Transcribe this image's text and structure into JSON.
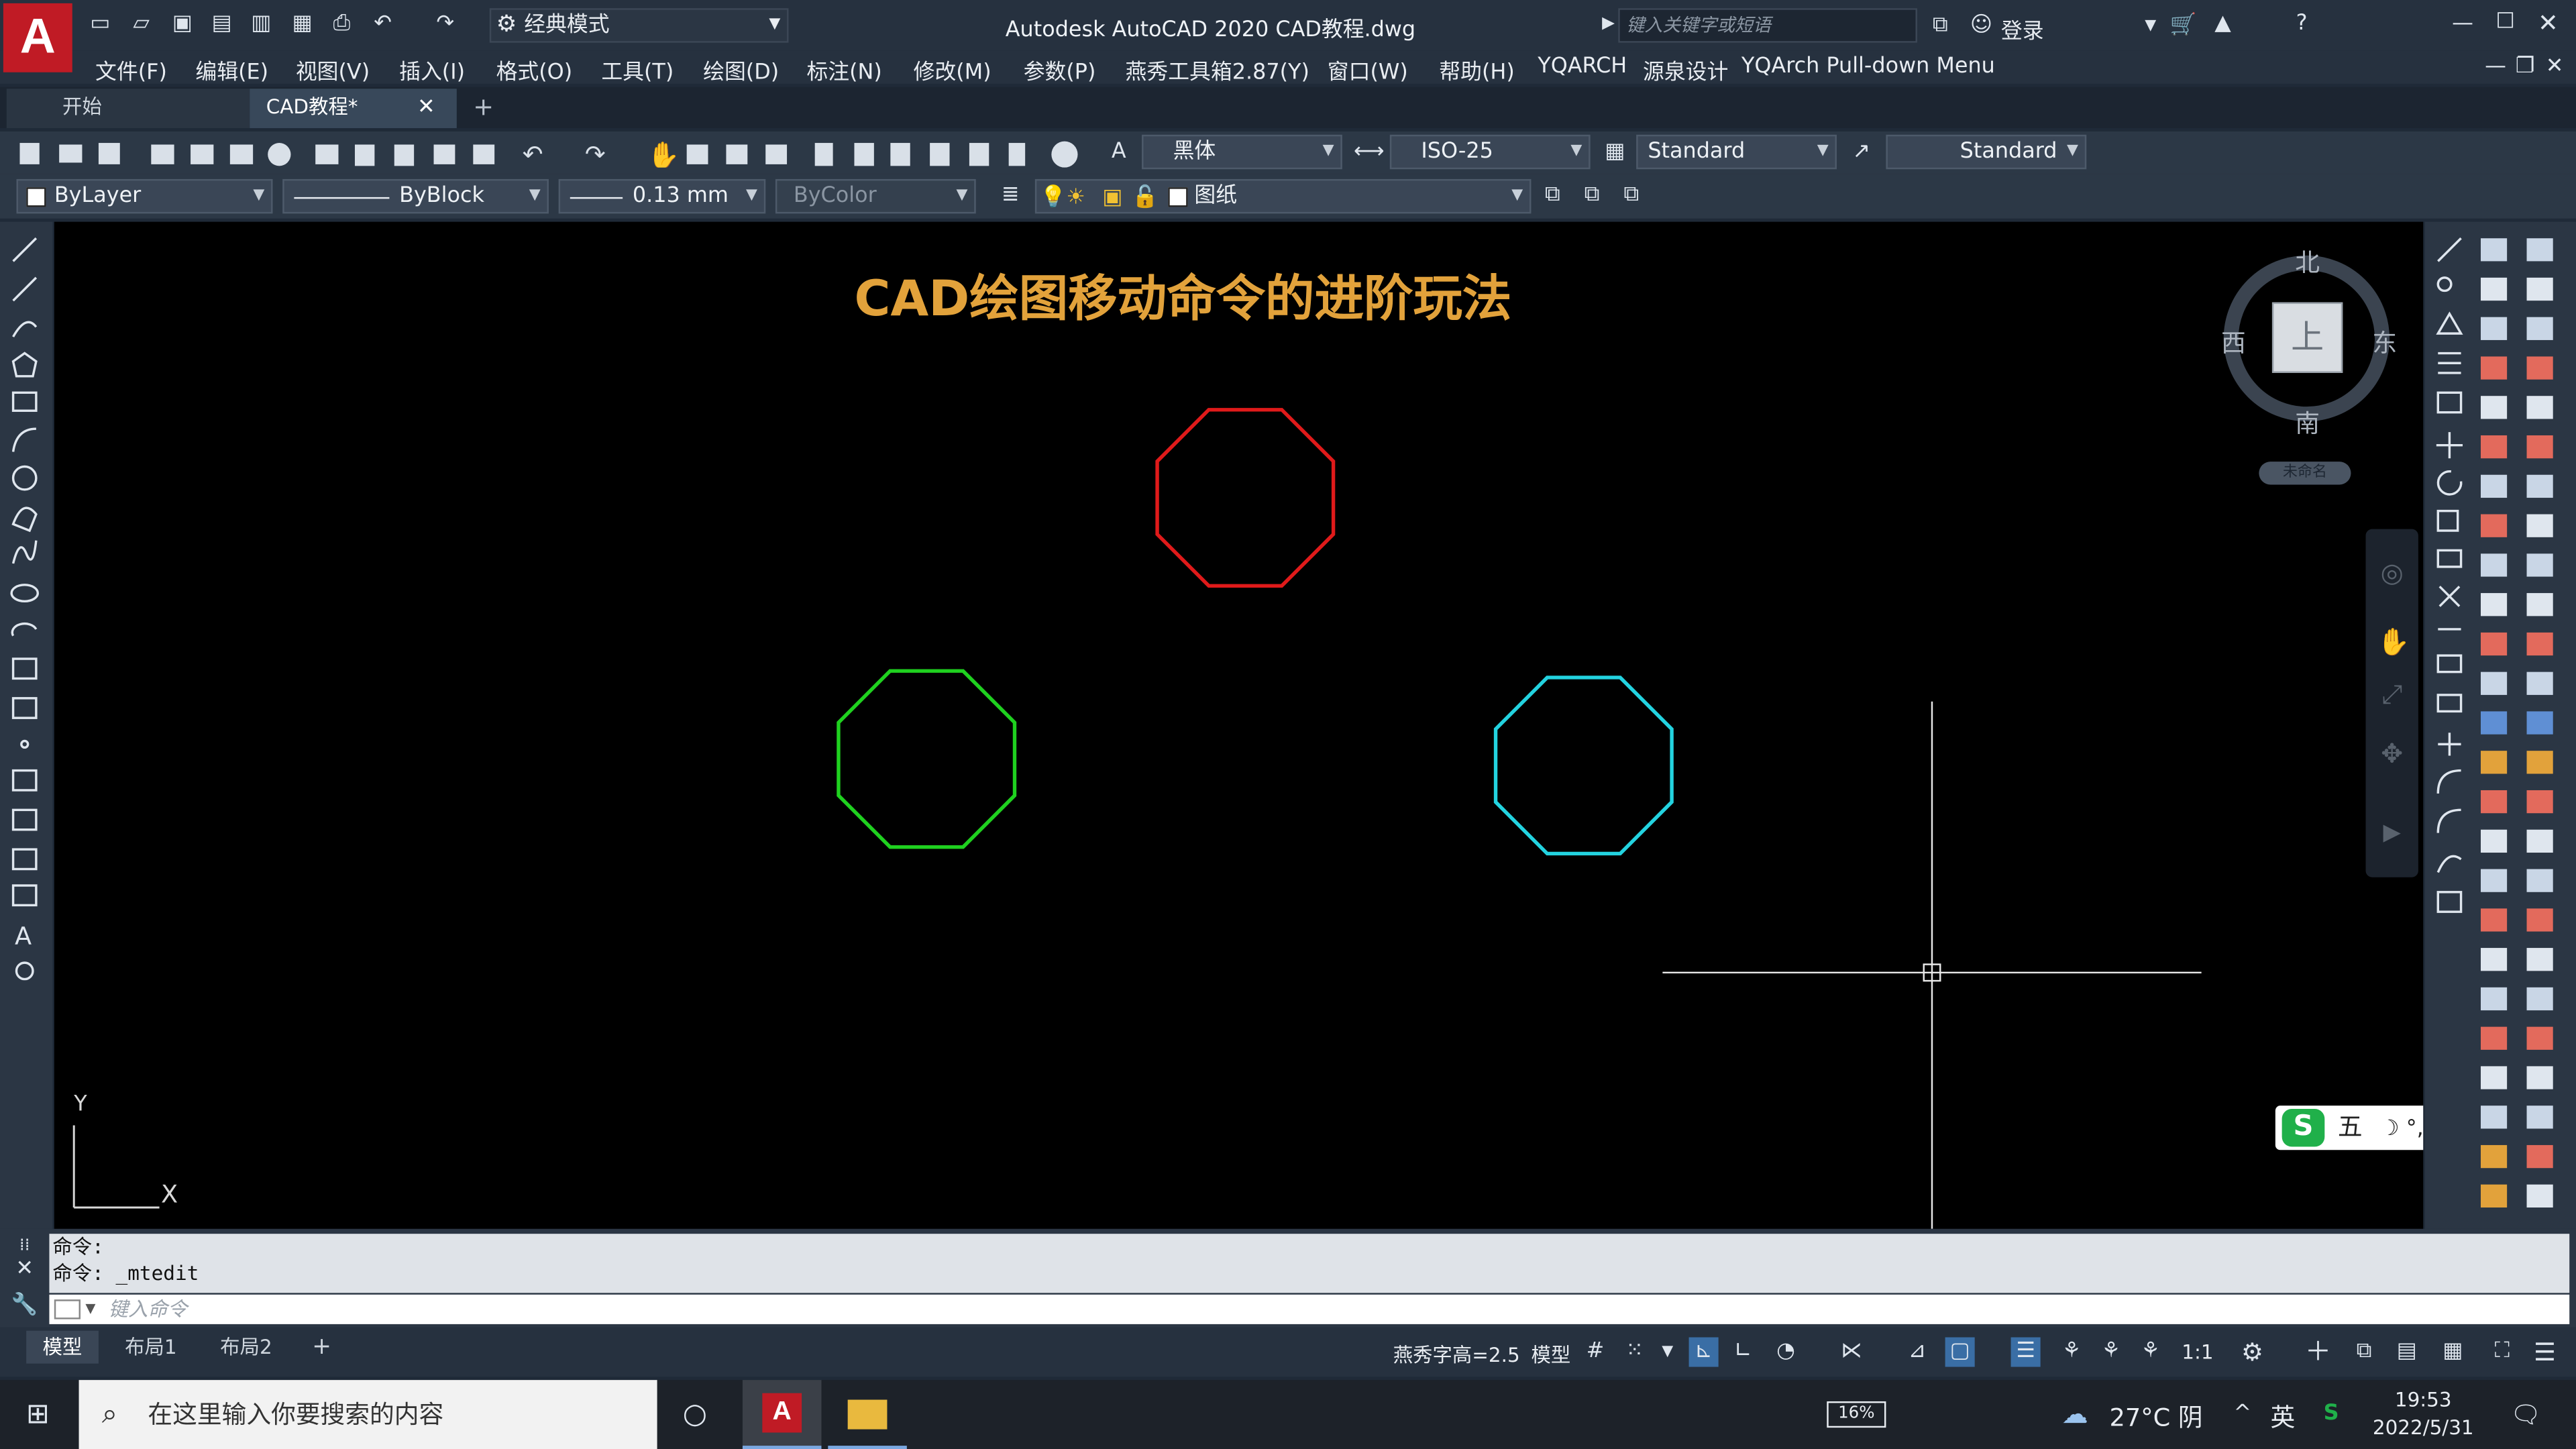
{
  "window": {
    "app_logo": "A",
    "title": "Autodesk AutoCAD 2020    CAD教程.dwg",
    "workspace": "经典模式",
    "search_placeholder": "键入关键字或短语",
    "login": "登录"
  },
  "menus": [
    "文件(F)",
    "编辑(E)",
    "视图(V)",
    "插入(I)",
    "格式(O)",
    "工具(T)",
    "绘图(D)",
    "标注(N)",
    "修改(M)",
    "参数(P)",
    "燕秀工具箱2.87(Y)",
    "窗口(W)",
    "帮助(H)",
    "YQARCH",
    "源泉设计",
    "YQArch Pull-down Menu"
  ],
  "tabs": {
    "start": "开始",
    "drawing": "CAD教程*",
    "close": "✕",
    "add": "+"
  },
  "toolbar1": {
    "text_style_font": "黑体",
    "dim_style": "ISO-25",
    "table_style": "Standard",
    "multileader_style": "Standard"
  },
  "toolbar2": {
    "layer_color": "ByLayer",
    "linetype": "ByBlock",
    "lineweight": "0.13 mm",
    "plot_style": "ByColor",
    "layer_name": "图纸"
  },
  "canvas": {
    "title_text": "CAD绘图移动命令的进阶玩法",
    "octagons": [
      {
        "color": "#e01a1a"
      },
      {
        "color": "#1fd11f"
      },
      {
        "color": "#23d3e0"
      }
    ],
    "ucs_y": "Y",
    "ucs_x": "X",
    "viewcube": {
      "north": "北",
      "south": "南",
      "west": "西",
      "east": "东",
      "top": "上",
      "wcs": "未命名"
    }
  },
  "ime": {
    "logo": "S",
    "mode": "五",
    "icons": "☽ °, ⌨ ♟ ⁘"
  },
  "command": {
    "history": [
      "命令:",
      "命令: _mtedit"
    ],
    "placeholder": "键入命令"
  },
  "statusbar": {
    "layout_tabs": [
      "模型",
      "布局1",
      "布局2"
    ],
    "add": "+",
    "text_height": "燕秀字高=2.5",
    "model": "模型",
    "scale": "1:1"
  },
  "taskbar": {
    "search_placeholder": "在这里输入你要搜索的内容",
    "battery": "16%",
    "weather": "27°C 阴",
    "ime_lang": "英",
    "time": "19:53",
    "date": "2022/5/31"
  },
  "colors": {
    "accent": "#c01b25",
    "canvas_bg": "#000000",
    "title_gold": "#e2a23b"
  }
}
